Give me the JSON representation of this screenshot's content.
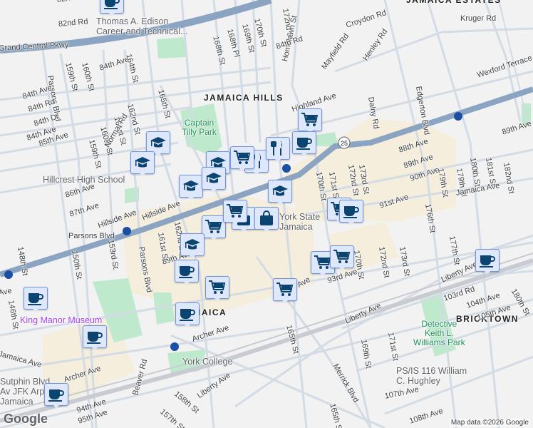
{
  "map": {
    "neighborhoods": [
      "JAMAICA ESTATES",
      "JAMAICA HILLS",
      "BRICKTOWN",
      "JAMAICA"
    ],
    "parks": [
      "Captain\nTilly Park",
      "Detective\nKeith L.\nWilliams Park"
    ],
    "pois": {
      "edison": "Thomas A. Edison\nCareer and Technical...",
      "hillcrest": "Hillcrest High School",
      "york": "York College",
      "ps116": "PS/IS 116 William\nC. Hughley",
      "king_manor": "King Manor Museum",
      "ny_state": "York State\nJamaica",
      "sutphin": "Sutphin Blvd\nAv JFK Arp\nJamaica"
    },
    "streets": [
      "82nd Dr",
      "82nd Rd",
      "Grand Central Pkwy",
      "Parsons Blvd",
      "159th St",
      "160th St",
      "84th Ave",
      "164th St",
      "84th Ave",
      "84th Rd",
      "84th Dr",
      "84th Ave",
      "85th Ave",
      "162nd St",
      "161st St",
      "160th St",
      "159th St",
      "Normal Rd",
      "165th St",
      "168th St",
      "168th Pl",
      "169th St",
      "170th St",
      "172nd St",
      "Homelawn St",
      "84th Rd",
      "Croydon Rd",
      "Mayfield Rd",
      "Henley Rd",
      "Kruger Rd",
      "Dalny Rd",
      "Edgerton Blvd",
      "Wexford Terrace",
      "Highland Ave",
      "88th Ave",
      "89th Ave",
      "90th Ave",
      "91st Ave",
      "171st St",
      "172nd St",
      "173rd St",
      "170th St",
      "179th St",
      "179th Pl",
      "180th St",
      "181st St",
      "182nd St",
      "89th Ave",
      "176th St",
      "86th Ave",
      "87th Ave",
      "Hillside Ave",
      "Parsons Blvd",
      "148th St",
      "150th St",
      "153rd St",
      "Parsons Blvd",
      "146th St",
      "89th Ave",
      "Jamaica Ave",
      "Archer Ave",
      "Archer Ave",
      "Beaver Rd",
      "158th St",
      "157th St",
      "94th Ave",
      "95th Ave",
      "Liberty Ave",
      "Jamaica Ave",
      "172nd St",
      "173rd St",
      "177th St",
      "170th St",
      "93rd Ave",
      "Archer Ave",
      "165th St",
      "Liberty Ave",
      "103rd Rd",
      "104th Ave",
      "105th Ave",
      "Liberty Ave",
      "169th St",
      "171st St",
      "Merrick Blvd",
      "107th Ave",
      "108th Ave",
      "165th St",
      "180th St",
      "161st St",
      "162nd St",
      "Hillside Ave",
      "Ave"
    ],
    "route_shield": "25"
  },
  "markers": [
    "coffee",
    "graduation-cap",
    "graduation-cap",
    "graduation-cap",
    "graduation-cap",
    "graduation-cap",
    "shopping-cart",
    "coffee",
    "restaurant",
    "shopping-cart",
    "restaurant",
    "graduation-cap",
    "shopping-bag",
    "shopping-bag",
    "shopping-cart",
    "graduation-cap",
    "coffee",
    "shopping-cart",
    "coffee",
    "coffee",
    "coffee",
    "coffee",
    "shopping-cart",
    "coffee",
    "shopping-cart",
    "shopping-cart",
    "shopping-cart",
    "coffee",
    "shopping-cart"
  ],
  "attribution": "Map data ©2026 Google",
  "logo": "Google",
  "colors": {
    "highway": "#8aa4c1",
    "road": "#d3dbe4",
    "commercial": "#f6eedc",
    "park": "#bfe9cc",
    "marker_bg": "#dfe8fb",
    "marker_border": "#6d95e0",
    "icon": "#0b4470"
  }
}
